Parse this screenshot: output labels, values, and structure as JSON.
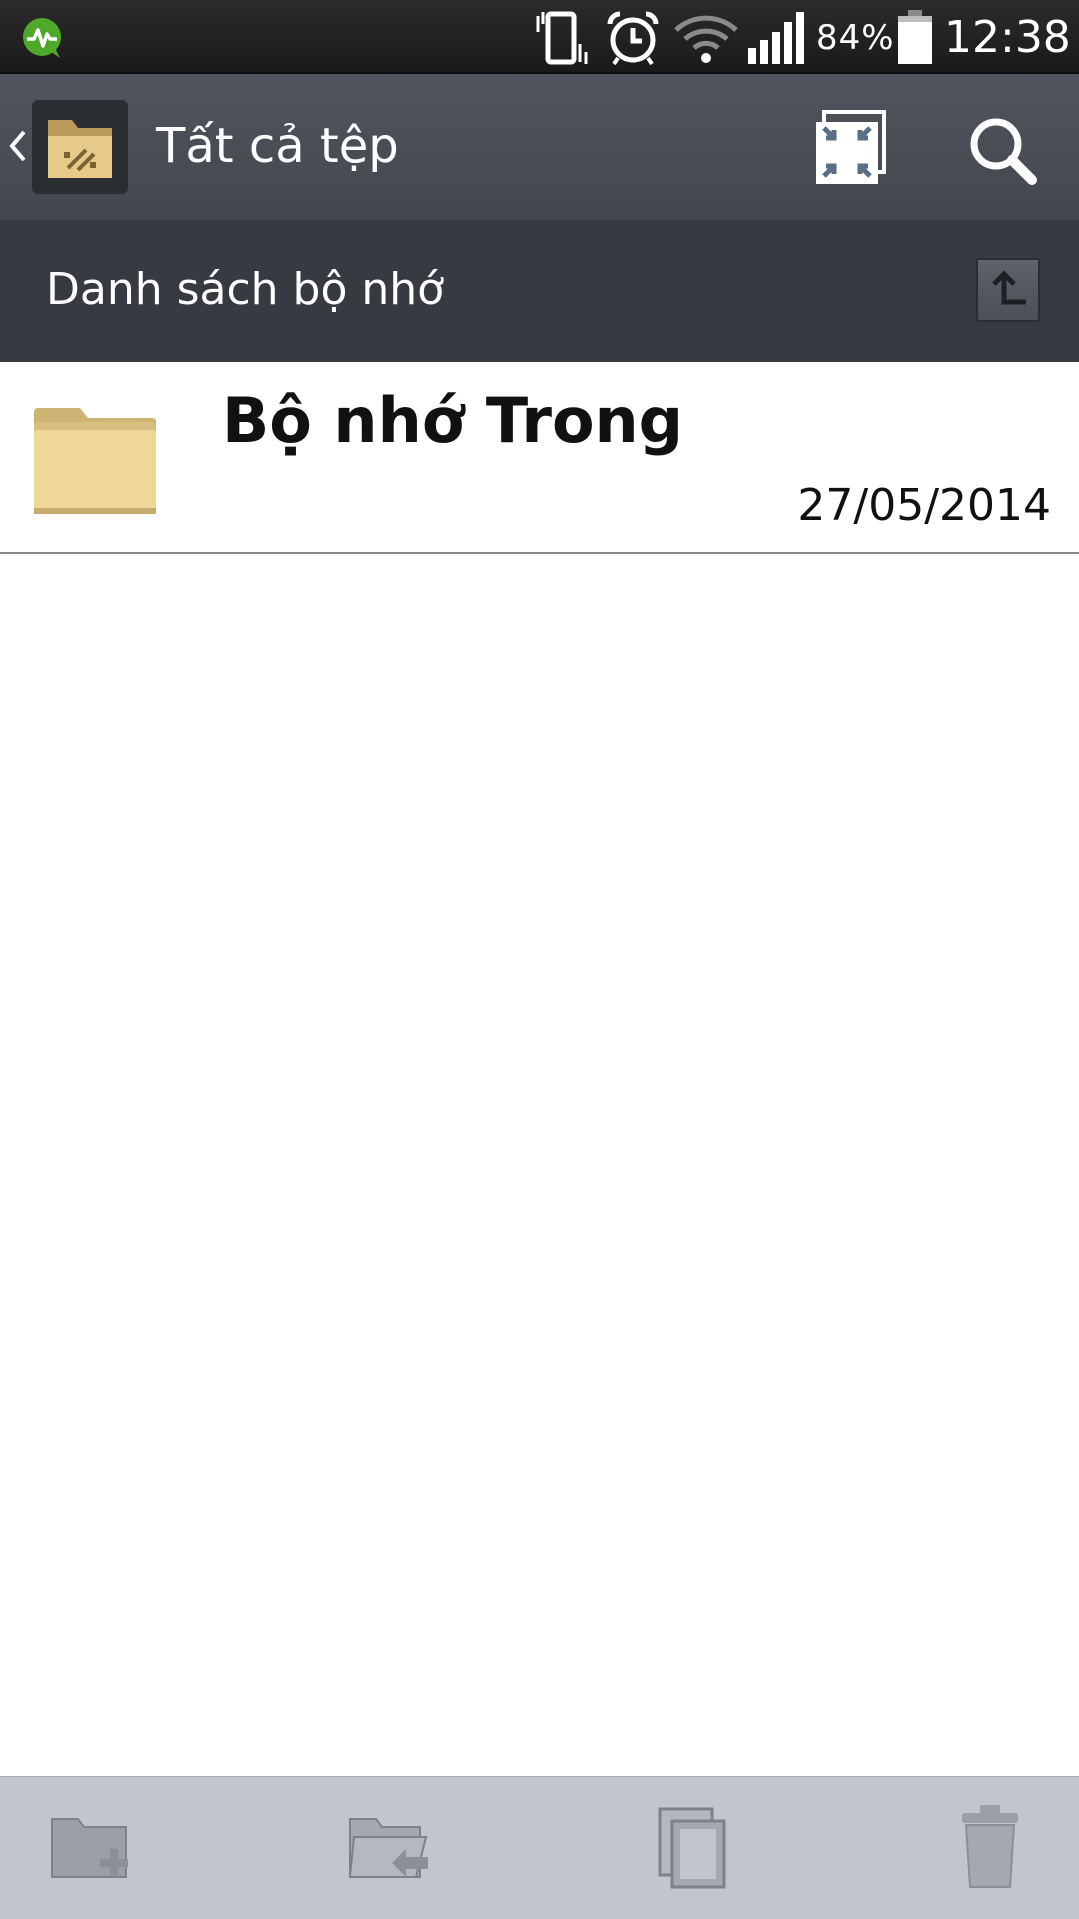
{
  "status_bar": {
    "battery_percent": "84%",
    "time": "12:38",
    "icons": [
      "app-notification-icon",
      "vibrate-icon",
      "alarm-icon",
      "wifi-icon",
      "signal-icon",
      "battery-icon"
    ]
  },
  "action_bar": {
    "title": "Tất cả tệp",
    "icons": [
      "back-chevron-icon",
      "file-manager-app-icon",
      "shrink-view-icon",
      "search-icon"
    ]
  },
  "list_header": {
    "title": "Danh sách bộ nhớ",
    "up_icon": "up-arrow-icon"
  },
  "files": [
    {
      "name": "Bộ nhớ Trong",
      "date": "27/05/2014",
      "icon": "folder-icon"
    }
  ],
  "toolbar": {
    "items": [
      "new-folder-icon",
      "move-icon",
      "copy-icon",
      "delete-icon"
    ]
  },
  "colors": {
    "status_bar": "#1f1f1f",
    "action_bar": "#4a4e55",
    "list_header": "#373a40",
    "folder": "#e8cf8e",
    "bottom_bar": "#c1c6ce"
  }
}
